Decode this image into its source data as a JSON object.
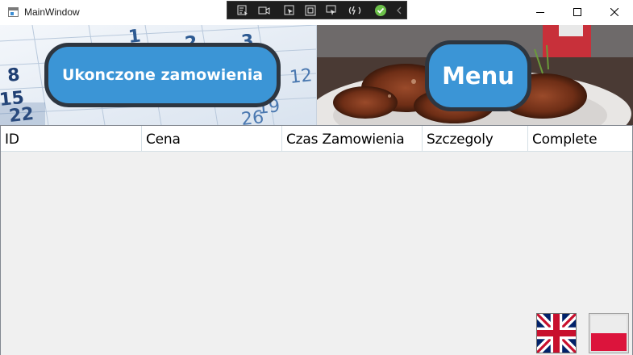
{
  "window": {
    "title": "MainWindow",
    "icon": "app-window-icon",
    "controls": [
      "minimize-icon",
      "maximize-icon",
      "close-icon"
    ]
  },
  "debug_toolbar": {
    "icons": [
      "visual-tree-icon",
      "record-icon",
      "select-element-icon",
      "display-layout-adorners-icon",
      "track-focus-icon",
      "hot-reload-icon",
      "binding-check-icon",
      "collapse-chevron-icon"
    ]
  },
  "banner": {
    "completed_orders_button": "Ukonczone zamowienia",
    "menu_button": "Menu",
    "accent": "#3b95d6",
    "border": "#2e3640"
  },
  "grid": {
    "columns": [
      "ID",
      "Cena",
      "Czas Zamowienia",
      "Szczegoly",
      "Complete"
    ],
    "rows": []
  },
  "language_flags": [
    "uk-flag-icon",
    "poland-flag-icon"
  ]
}
